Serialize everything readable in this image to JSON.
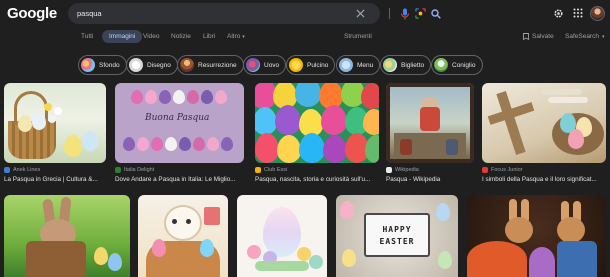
{
  "header": {
    "logo": "Google",
    "search_value": "pasqua"
  },
  "tabs": {
    "items": [
      "Tutti",
      "Immagini",
      "Video",
      "Notizie",
      "Libri",
      "Altro"
    ],
    "active": "Immagini",
    "tools": "Strumenti",
    "saved": "Salvate",
    "safesearch": "SafeSearch"
  },
  "chips": [
    {
      "label": "Sfondo"
    },
    {
      "label": "Disegno"
    },
    {
      "label": "Resurrezione"
    },
    {
      "label": "Uovo"
    },
    {
      "label": "Pulcino"
    },
    {
      "label": "Menu"
    },
    {
      "label": "Biglietto"
    },
    {
      "label": "Coniglio"
    }
  ],
  "results_row1": [
    {
      "source": "Anek Lines",
      "title": "La Pasqua in Grecia | Cultura &..."
    },
    {
      "source": "Italia Delight",
      "title": "Dove Andare a Pasqua in Italia: Le Miglio..."
    },
    {
      "source": "Club Essi",
      "title": "Pasqua, nascita, storia e curiosità sull'u..."
    },
    {
      "source": "Wikipedia",
      "title": "Pasqua - Wikipedia"
    },
    {
      "source": "Focus Junior",
      "title": "I simboli della Pasqua e il loro significat..."
    }
  ],
  "image_text": {
    "buona_pasqua": "Buona Pasqua",
    "happy": "HAPPY",
    "easter": "EASTER"
  },
  "colors": {
    "background": "#1f1f1f",
    "searchbox": "#303134",
    "active_tab_bg": "#394457",
    "accent": "#8ab4f8"
  }
}
